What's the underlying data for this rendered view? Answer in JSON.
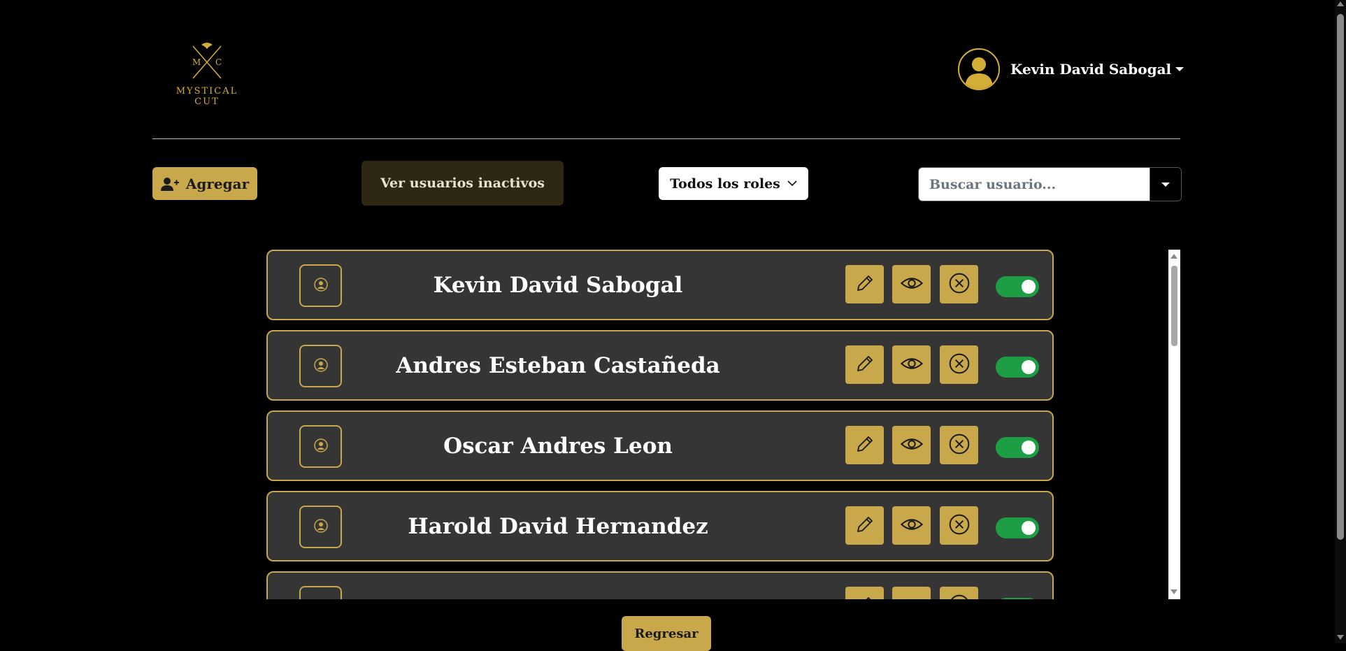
{
  "logo": {
    "monogram_left": "M",
    "monogram_right": "C",
    "brand_line1": "MYSTICAL",
    "brand_line2": "CUT"
  },
  "user_menu": {
    "name": "Kevin David Sabogal",
    "avatar_icon": "user-avatar-icon"
  },
  "toolbar": {
    "add_label": "Agregar",
    "inactive_label": "Ver usuarios inactivos",
    "role_filter_value": "Todos los roles",
    "search_placeholder": "Buscar usuario..."
  },
  "users": [
    {
      "name": "Kevin David Sabogal",
      "active": true
    },
    {
      "name": "Andres Esteban Castañeda",
      "active": true
    },
    {
      "name": "Oscar Andres Leon",
      "active": true
    },
    {
      "name": "Harold David Hernandez",
      "active": true
    }
  ],
  "back_label": "Regresar",
  "colors": {
    "accent": "#c9a84c",
    "toggle_on": "#1e9e44",
    "card_bg": "#353535",
    "page_bg": "#000000"
  }
}
